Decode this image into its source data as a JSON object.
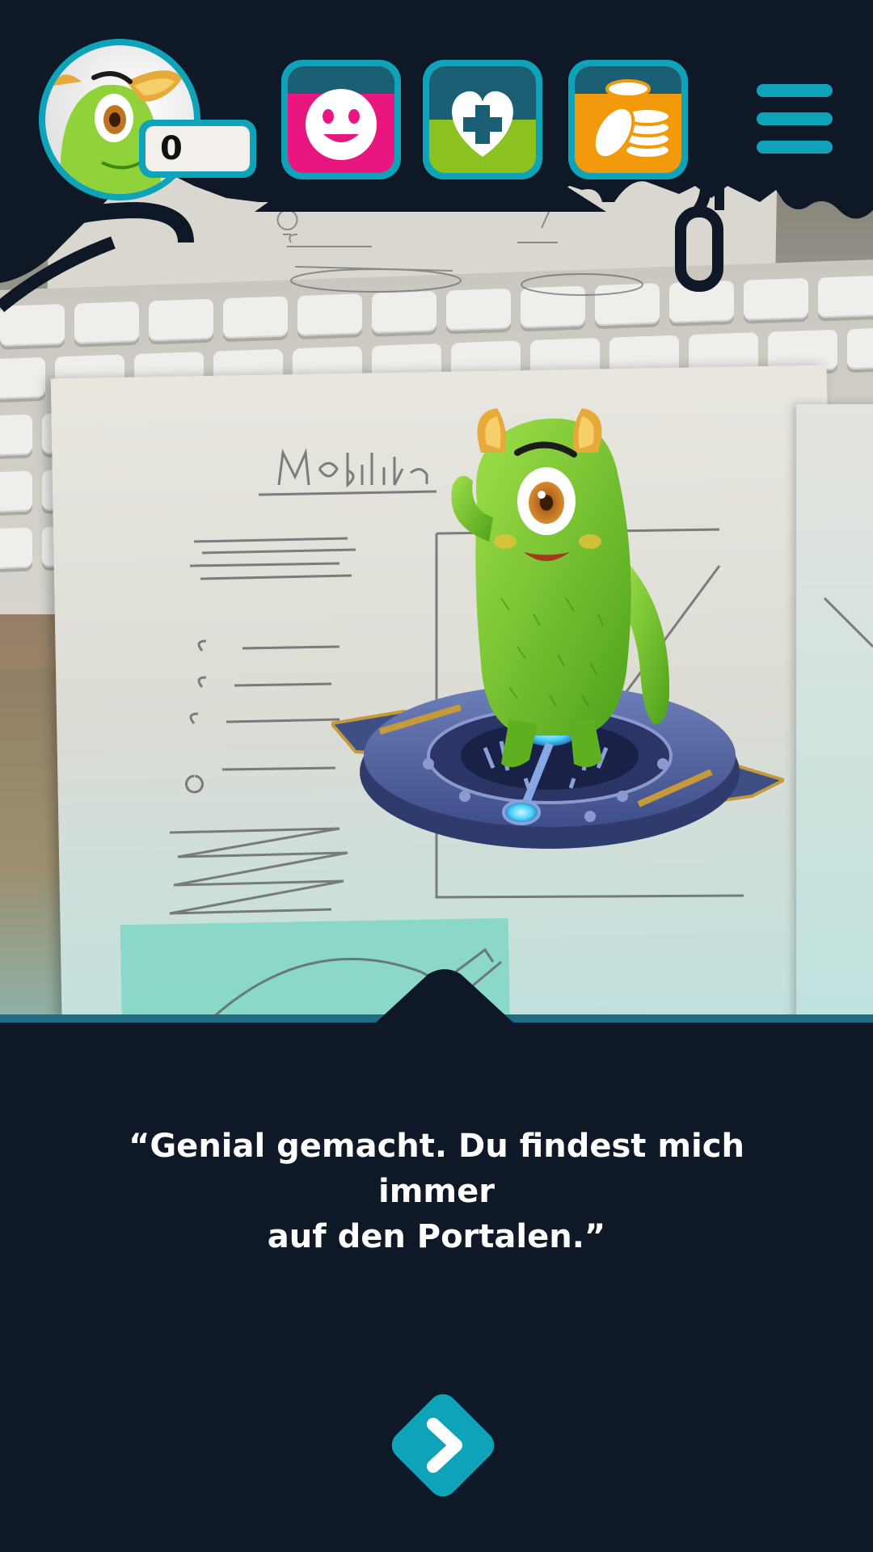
{
  "hud": {
    "score": "0",
    "buttons": [
      {
        "name": "mood",
        "icon": "smiley-face-icon",
        "color": "#e8167e"
      },
      {
        "name": "health",
        "icon": "heart-plus-icon",
        "color": "#8cc21f"
      },
      {
        "name": "coins",
        "icon": "coins-icon",
        "color": "#f39a0c"
      }
    ],
    "menu_icon": "hamburger-menu-icon"
  },
  "dialog": {
    "line1": "“Genial gemacht. Du findest mich immer",
    "line2": "auf den Portalen.”"
  },
  "navigation": {
    "next_icon": "chevron-right-icon"
  },
  "colors": {
    "accent": "#0fa3ba",
    "background": "#0f1826",
    "mood": "#e8167e",
    "health": "#8cc21f",
    "coins": "#f39a0c",
    "hud_dark_teal": "#1b5f74"
  }
}
